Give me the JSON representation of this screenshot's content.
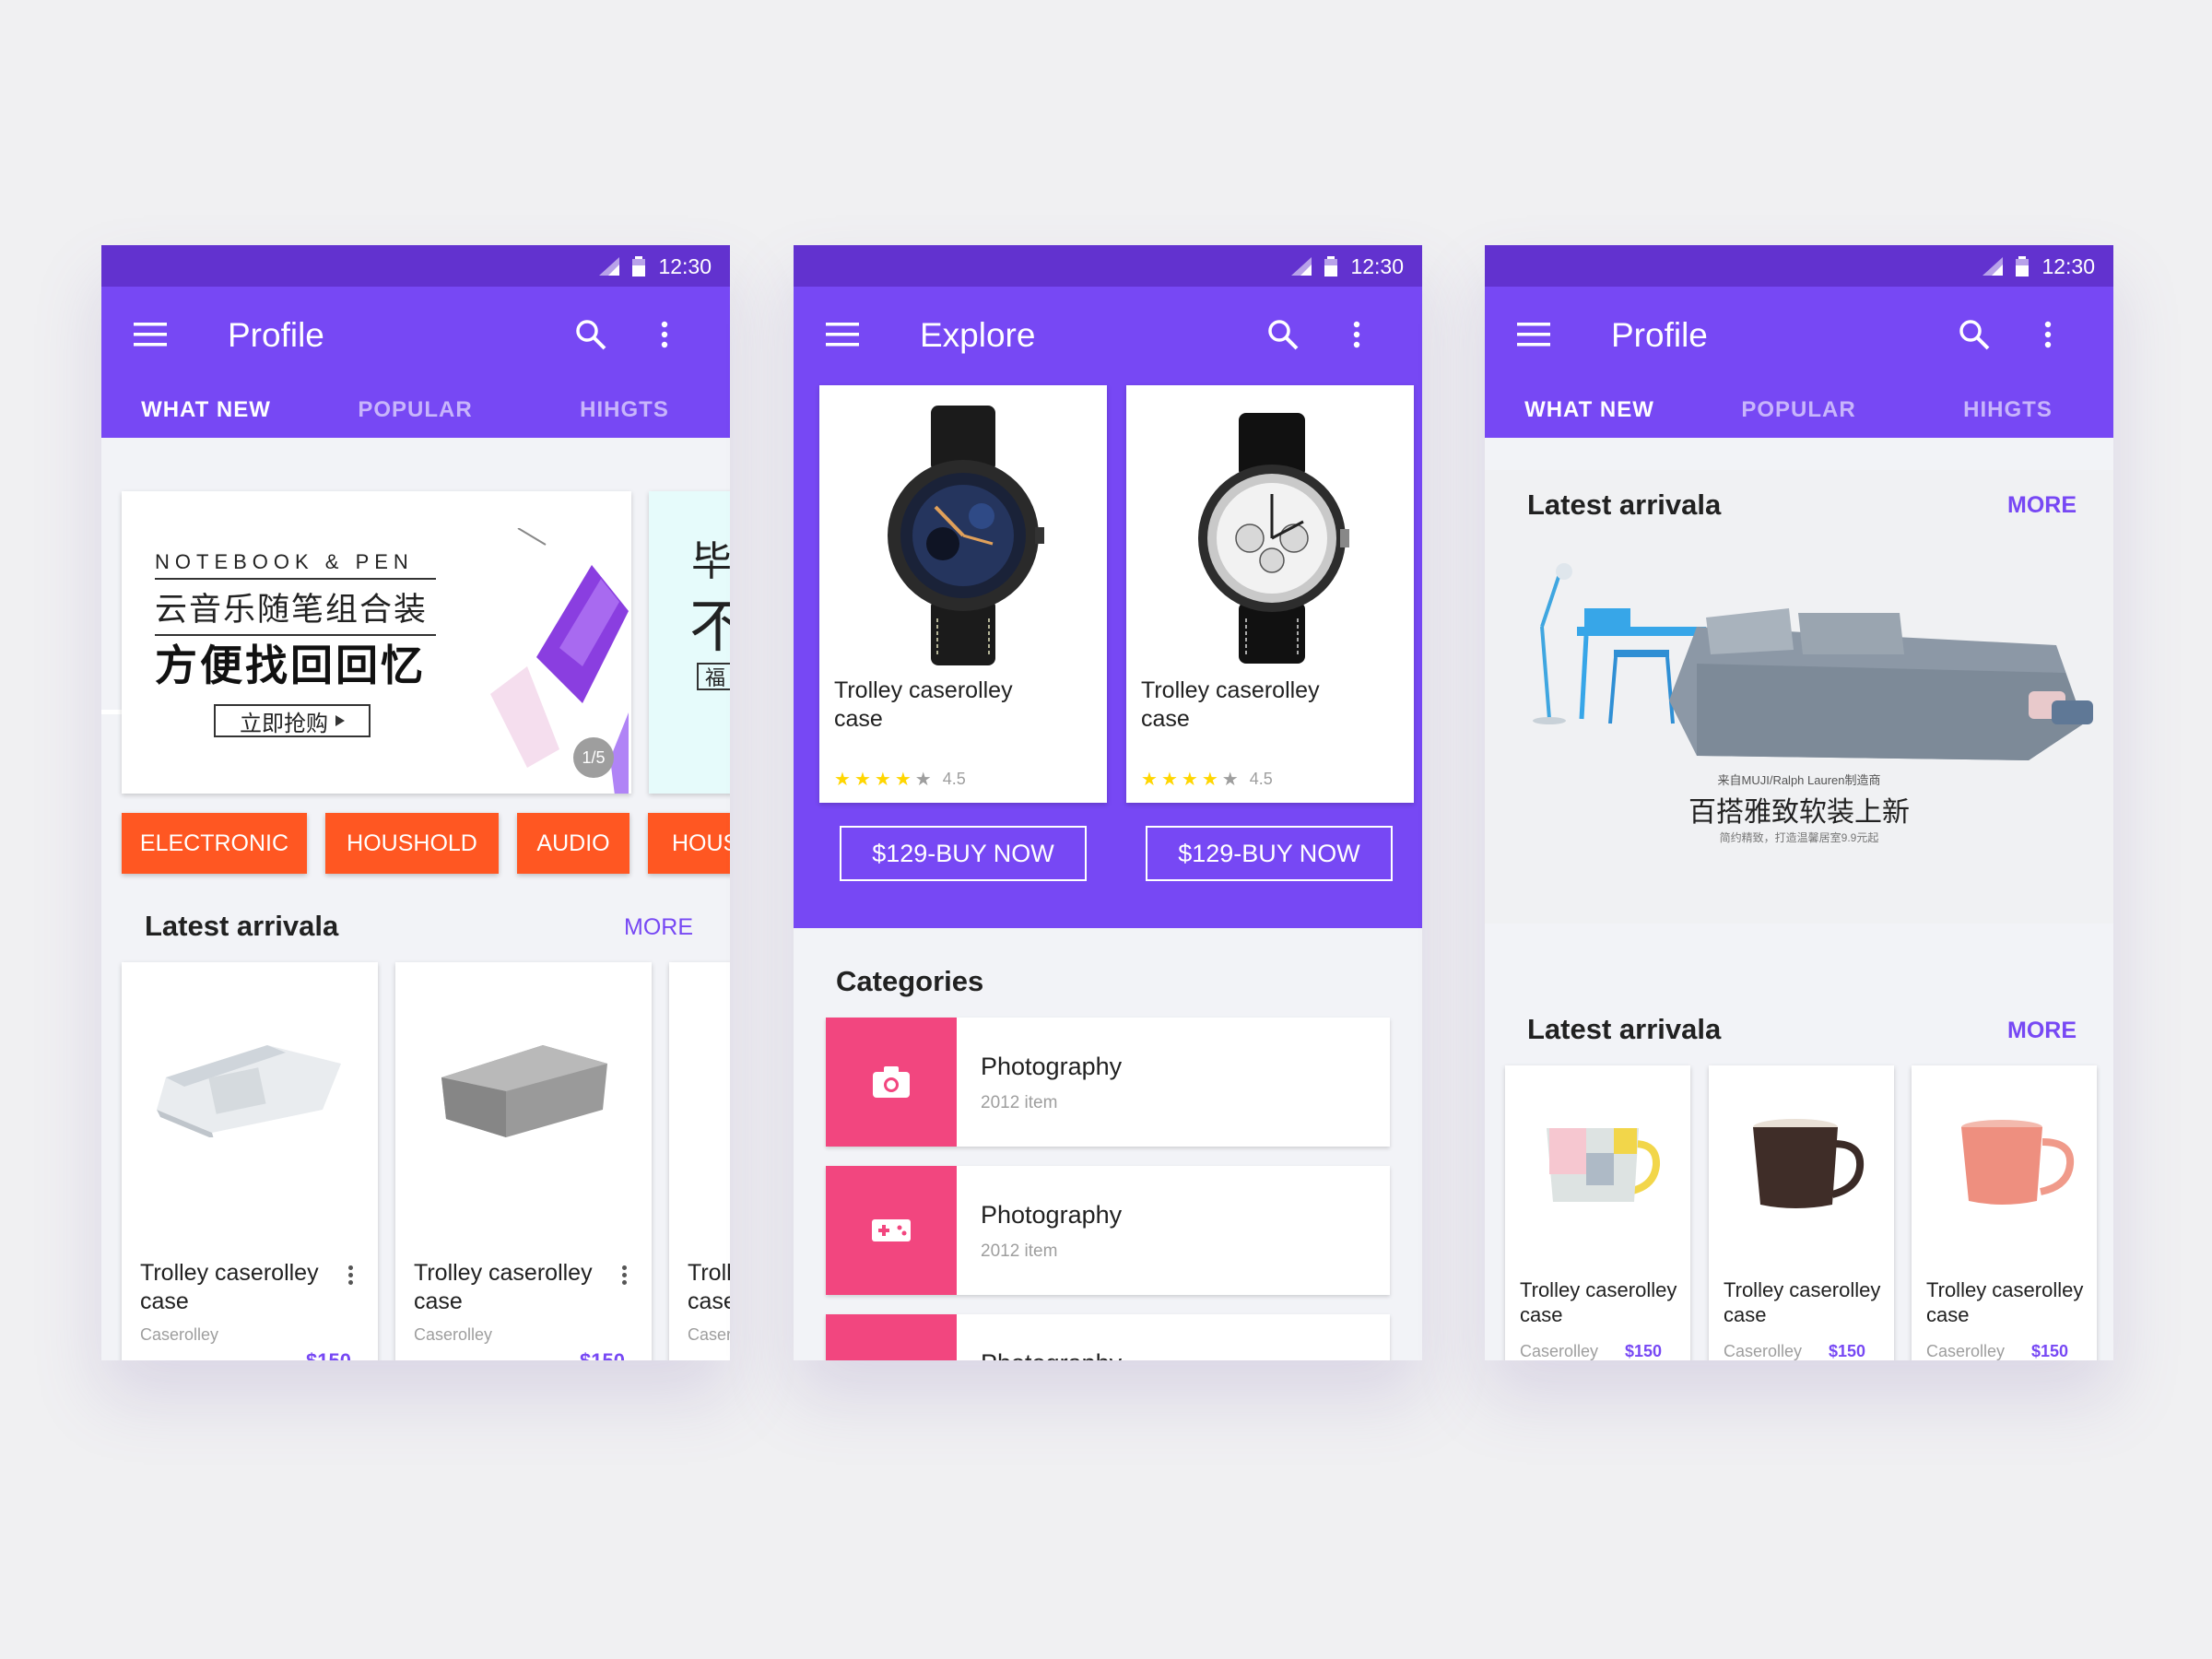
{
  "colors": {
    "primary": "#7748f4",
    "primary_dark": "#6232cf",
    "accent_orange": "#ff5722",
    "accent_pink": "#f2467f"
  },
  "status_time": "12:30",
  "screens": [
    {
      "title": "Profile",
      "tabs": [
        "WHAT NEW",
        "POPULAR",
        "HIHGTS"
      ],
      "banner": {
        "line1": "NOTEBOOK & PEN",
        "line2": "云音乐随笔组合装",
        "line3": "方便找回回忆",
        "cta": "立即抢购",
        "pager": "1/5",
        "peek_line1": "毕",
        "peek_line2": "不",
        "peek_line3": "福"
      },
      "chips": [
        "ELECTRONIC",
        "HOUSHOLD",
        "AUDIO",
        "HOUS"
      ],
      "section_title": "Latest arrivala",
      "more": "MORE",
      "products": [
        {
          "name": "Trolley caserolley case",
          "sub": "Caserolley",
          "price": "$150"
        },
        {
          "name": "Trolley caserolley case",
          "sub": "Caserolley",
          "price": "$150"
        },
        {
          "name": "Trolley caserolley case",
          "sub": "Caserolley",
          "price": ""
        }
      ]
    },
    {
      "title": "Explore",
      "watches": [
        {
          "name": "Trolley caserolley case",
          "rating": "4.5",
          "button": "$129-BUY NOW"
        },
        {
          "name": "Trolley caserolley case",
          "rating": "4.5",
          "button": "$129-BUY NOW"
        }
      ],
      "categories_title": "Categories",
      "categories": [
        {
          "icon": "camera-icon",
          "title": "Photography",
          "sub": "2012 item"
        },
        {
          "icon": "gamepad-icon",
          "title": "Photography",
          "sub": "2012 item"
        },
        {
          "icon": "category-icon",
          "title": "Photography",
          "sub": ""
        }
      ]
    },
    {
      "title": "Profile",
      "tabs": [
        "WHAT NEW",
        "POPULAR",
        "HIHGTS"
      ],
      "hero": {
        "section_title": "Latest arrivala",
        "more": "MORE",
        "caption_small": "来自MUJI/Ralph Lauren制造商",
        "caption_main": "百搭雅致软装上新",
        "caption_sub": "简约精致，打造温馨居室9.9元起"
      },
      "section_title": "Latest arrivala",
      "more": "MORE",
      "products": [
        {
          "name": "Trolley caserolley case",
          "sub": "Caserolley",
          "price": "$150"
        },
        {
          "name": "Trolley caserolley case",
          "sub": "Caserolley",
          "price": "$150"
        },
        {
          "name": "Trolley caserolley case",
          "sub": "Caserolley",
          "price": "$150"
        }
      ]
    }
  ]
}
